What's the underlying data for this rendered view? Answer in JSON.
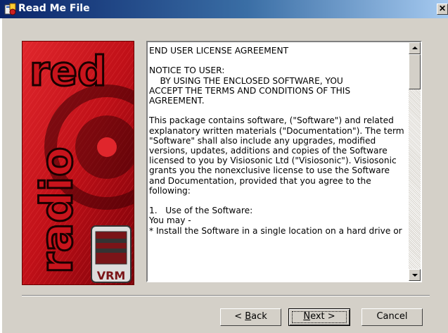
{
  "window": {
    "title": "Read Me File",
    "close_glyph": "✕"
  },
  "banner": {
    "logo_text": "red",
    "vertical_text": "radio",
    "brand_text": "VRM"
  },
  "license": {
    "text": "END USER LICENSE AGREEMENT\n\nNOTICE TO USER:\n    BY USING THE ENCLOSED SOFTWARE, YOU\nACCEPT THE TERMS AND CONDITIONS OF THIS\nAGREEMENT.\n\nThis package contains software, (\"Software\") and related\nexplanatory written materials (\"Documentation\"). The term\n\"Software\" shall also include any upgrades, modified\nversions, updates, additions and copies of the Software\nlicensed to you by Visiosonic Ltd (\"Visiosonic\"). Visiosonic\ngrants you the nonexclusive license to use the Software\nand Documentation, provided that you agree to the\nfollowing:\n\n1.   Use of the Software:\nYou may -\n* Install the Software in a single location on a hard drive or"
  },
  "buttons": {
    "back_prefix": "< ",
    "back_mnemonic": "B",
    "back_rest": "ack",
    "next_mnemonic": "N",
    "next_rest": "ext >",
    "cancel": "Cancel"
  },
  "colors": {
    "banner_red": "#c8141c",
    "title_bar": "#0a246a"
  }
}
